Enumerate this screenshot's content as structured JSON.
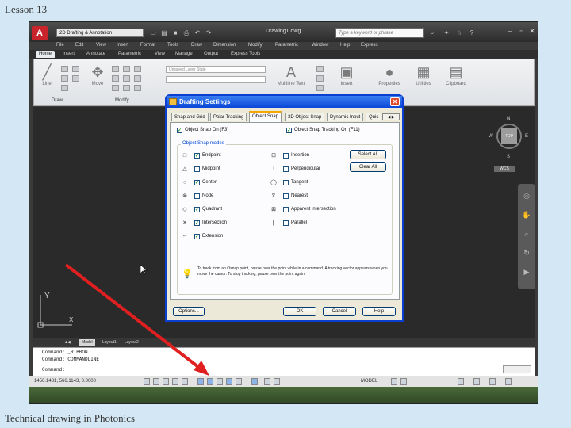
{
  "slide": {
    "title": "Lesson 13",
    "footer": "Technical drawing in Photonics"
  },
  "app": {
    "logo": "A",
    "workspace": "2D Drafting & Annotation",
    "doc_title": "Drawing1.dwg",
    "search_placeholder": "Type a keyword or phrase",
    "menus": [
      "File",
      "Edit",
      "View",
      "Insert",
      "Format",
      "Tools",
      "Draw",
      "Dimension",
      "Modify",
      "Parametric",
      "Window",
      "Help",
      "Express"
    ],
    "ribbon_tabs": [
      "Home",
      "Insert",
      "Annotate",
      "Parametric",
      "View",
      "Manage",
      "Output",
      "Express Tools"
    ],
    "active_ribbon_tab": "Home",
    "ribbon": {
      "line": "Line",
      "move": "Move",
      "layer": "Unsaved Layer State",
      "multiline_text": "Multiline Text",
      "insert": "Insert",
      "properties": "Properties",
      "utilities": "Utilities",
      "clipboard": "Clipboard",
      "draw_panel": "Draw",
      "modify_panel": "Modify"
    },
    "viewcube": {
      "n": "N",
      "s": "S",
      "e": "E",
      "w": "W",
      "top": "TOP",
      "wcs": "WCS"
    },
    "ucs": {
      "y": "Y",
      "x": "X"
    },
    "layout_tabs": [
      "Model",
      "Layout1",
      "Layout2"
    ],
    "active_layout_tab": "Model",
    "command_lines": [
      "Command: _RIBBON",
      "Command: COMMANDLINE",
      "Command:"
    ],
    "status": {
      "coords": "1456.1481, 566.1143, 0.0000",
      "model": "MODEL"
    }
  },
  "dialog": {
    "title": "Drafting Settings",
    "close": "✕",
    "tabs": [
      "Snap and Grid",
      "Polar Tracking",
      "Object Snap",
      "3D Object Snap",
      "Dynamic Input",
      "Quic"
    ],
    "active_tab": "Object Snap",
    "osnap_on": "Object Snap On (F3)",
    "tracking_on": "Object Snap Tracking On (F11)",
    "group_title": "Object Snap modes",
    "modes_left": [
      {
        "label": "Endpoint",
        "checked": true,
        "symbol": "□"
      },
      {
        "label": "Midpoint",
        "checked": false,
        "symbol": "△"
      },
      {
        "label": "Center",
        "checked": true,
        "symbol": "○"
      },
      {
        "label": "Node",
        "checked": false,
        "symbol": "⊗"
      },
      {
        "label": "Quadrant",
        "checked": true,
        "symbol": "◇"
      },
      {
        "label": "Intersection",
        "checked": true,
        "symbol": "✕"
      },
      {
        "label": "Extension",
        "checked": true,
        "symbol": "--"
      }
    ],
    "modes_right": [
      {
        "label": "Insertion",
        "checked": false,
        "symbol": "⊡"
      },
      {
        "label": "Perpendicular",
        "checked": false,
        "symbol": "⊥"
      },
      {
        "label": "Tangent",
        "checked": false,
        "symbol": "◯"
      },
      {
        "label": "Nearest",
        "checked": false,
        "symbol": "⧖"
      },
      {
        "label": "Apparent intersection",
        "checked": false,
        "symbol": "⊠"
      },
      {
        "label": "Parallel",
        "checked": false,
        "symbol": "∥"
      }
    ],
    "select_all": "Select All",
    "clear_all": "Clear All",
    "tip": "To track from an Osnap point, pause over the point while in a command. A tracking vector appears when you move the cursor. To stop tracking, pause over the point again.",
    "options": "Options...",
    "ok": "OK",
    "cancel": "Cancel",
    "help": "Help"
  },
  "colors": {
    "arrow": "#e02020",
    "dialog_title": "#0a46d8",
    "active_tab": "#f6a800"
  }
}
